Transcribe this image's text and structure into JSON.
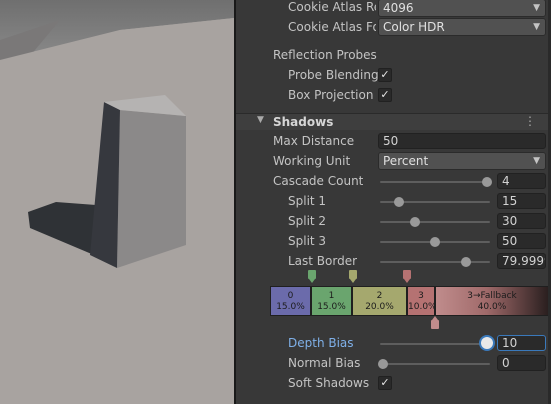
{
  "light": {
    "cookie_atlas_resolution_label": "Cookie Atlas Re",
    "cookie_atlas_resolution_value": "4096",
    "cookie_atlas_format_label": "Cookie Atlas Fo",
    "cookie_atlas_format_value": "Color HDR"
  },
  "reflection_probes": {
    "heading": "Reflection Probes",
    "probe_blending_label": "Probe Blending",
    "probe_blending_checked": true,
    "box_projection_label": "Box Projection",
    "box_projection_checked": true
  },
  "shadows": {
    "title": "Shadows",
    "max_distance_label": "Max Distance",
    "max_distance_value": "50",
    "working_unit_label": "Working Unit",
    "working_unit_value": "Percent",
    "cascade_count_label": "Cascade Count",
    "cascade_count_value": "4",
    "split1_label": "Split 1",
    "split1_value": "15",
    "split2_label": "Split 2",
    "split2_value": "30",
    "split3_label": "Split 3",
    "split3_value": "50",
    "last_border_label": "Last Border",
    "last_border_value": "79.9999",
    "cascades": [
      {
        "index": "0",
        "percent": "15.0%",
        "color": "#6b6bab"
      },
      {
        "index": "1",
        "percent": "15.0%",
        "color": "#6aa56e"
      },
      {
        "index": "2",
        "percent": "20.0%",
        "color": "#a5a86e"
      },
      {
        "index": "3",
        "percent": "10.0%",
        "color": "#b57272"
      },
      {
        "index": "3→Fallback",
        "percent": "40.0%",
        "color": "#c08c8c"
      }
    ],
    "depth_bias_label": "Depth Bias",
    "depth_bias_value": "10",
    "normal_bias_label": "Normal Bias",
    "normal_bias_value": "0",
    "soft_shadows_label": "Soft Shadows",
    "soft_shadows_checked": true
  },
  "icons": {
    "check": "✓",
    "dropdown_arrow": "▼",
    "fold_arrow": "▼",
    "kebab": "⋮"
  }
}
